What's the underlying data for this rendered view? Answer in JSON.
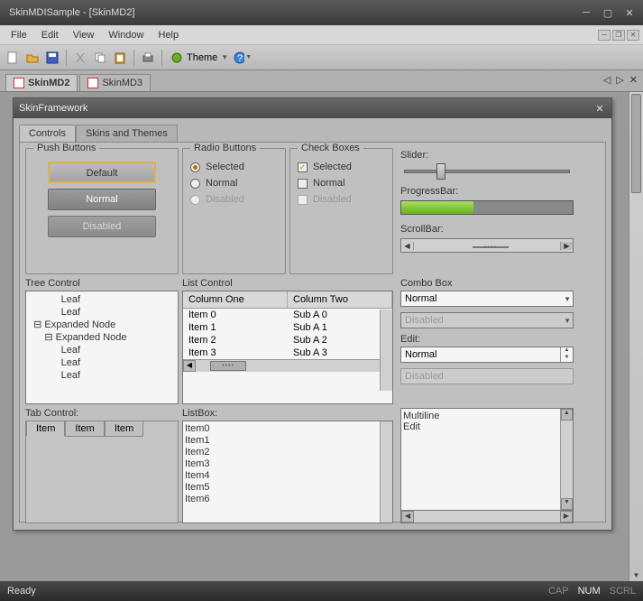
{
  "window": {
    "title": "SkinMDISample - [SkinMD2]"
  },
  "menu": [
    "File",
    "Edit",
    "View",
    "Window",
    "Help"
  ],
  "toolbar": {
    "theme_label": "Theme"
  },
  "doc_tabs": {
    "active": "SkinMD2",
    "other": "SkinMD3"
  },
  "child": {
    "title": "SkinFramework"
  },
  "inner_tabs": {
    "active": "Controls",
    "other": "Skins and Themes"
  },
  "push": {
    "legend": "Push Buttons",
    "default": "Default",
    "normal": "Normal",
    "disabled": "Disabled"
  },
  "radio": {
    "legend": "Radio Buttons",
    "selected": "Selected",
    "normal": "Normal",
    "disabled": "Disabled"
  },
  "check": {
    "legend": "Check Boxes",
    "selected": "Selected",
    "normal": "Normal",
    "disabled": "Disabled"
  },
  "slider": {
    "label": "Slider:"
  },
  "progress": {
    "label": "ProgressBar:"
  },
  "scrollbar": {
    "label": "ScrollBar:"
  },
  "tree": {
    "label": "Tree Control",
    "lines": [
      "            Leaf",
      "            Leaf",
      "  ⊟ Expanded Node",
      "      ⊟ Expanded Node",
      "            Leaf",
      "            Leaf",
      "            Leaf"
    ]
  },
  "list": {
    "label": "List Control",
    "col1": "Column One",
    "col2": "Column Two",
    "rows": [
      {
        "a": "Item 0",
        "b": "Sub A 0"
      },
      {
        "a": "Item 1",
        "b": "Sub A 1"
      },
      {
        "a": "Item 2",
        "b": "Sub A 2"
      },
      {
        "a": "Item 3",
        "b": "Sub A 3"
      }
    ]
  },
  "combo": {
    "label": "Combo Box",
    "value": "Normal",
    "disabled": "Disabled"
  },
  "edit": {
    "label": "Edit:",
    "value": "Normal",
    "disabled": "Disabled"
  },
  "tabctl": {
    "label": "Tab Control:",
    "tabs": [
      "Item",
      "Item",
      "Item"
    ]
  },
  "listbox": {
    "label": "ListBox:",
    "items": [
      "Item0",
      "Item1",
      "Item2",
      "Item3",
      "Item4",
      "Item5",
      "Item6"
    ]
  },
  "multiline": {
    "line1": "Multiline",
    "line2": "Edit"
  },
  "status": {
    "ready": "Ready",
    "cap": "CAP",
    "num": "NUM",
    "scrl": "SCRL"
  }
}
